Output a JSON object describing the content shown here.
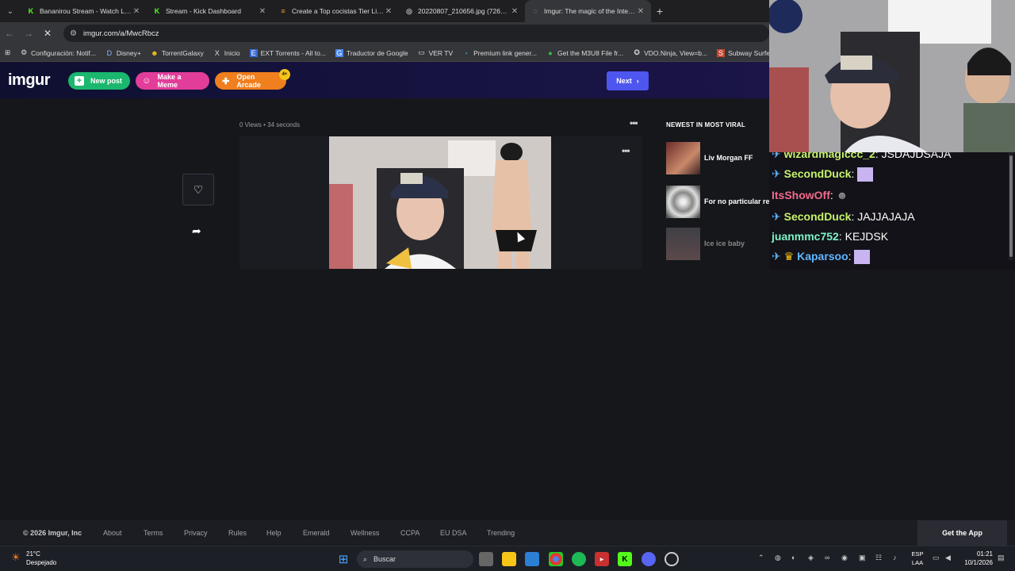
{
  "browser": {
    "tabs": [
      {
        "title": "Bananirou Stream - Watch Live",
        "icon": "kick-icon",
        "color": "#53fc18"
      },
      {
        "title": "Stream - Kick Dashboard",
        "icon": "kick-icon",
        "color": "#53fc18"
      },
      {
        "title": "Create a Top cocistas Tier List -",
        "icon": "tierlist-icon",
        "color": "#e0a030"
      },
      {
        "title": "20220807_210656.jpg (726×96…",
        "icon": "globe-icon",
        "color": "#bbbbbb"
      },
      {
        "title": "Imgur: The magic of the Interne",
        "icon": "loading-icon",
        "color": "#bbbbbb"
      }
    ],
    "url": "imgur.com/a/MwcRbcz",
    "bookmarks": [
      {
        "label": "Configuración: Notif...",
        "icon": "gear-icon"
      },
      {
        "label": "Disney+",
        "icon": "disney-icon"
      },
      {
        "label": "TorrentGalaxy",
        "icon": "galaxy-icon"
      },
      {
        "label": "Inicio",
        "icon": "x-icon"
      },
      {
        "label": "EXT Torrents - All to...",
        "icon": "ext-icon"
      },
      {
        "label": "Traductor de Google",
        "icon": "translate-icon"
      },
      {
        "label": "VER TV",
        "icon": "folder-icon"
      },
      {
        "label": "Premium link gener...",
        "icon": "link-icon"
      },
      {
        "label": "Get the M3U8 File fr...",
        "icon": "green-dot-icon"
      },
      {
        "label": "VDO.Ninja, View=b...",
        "icon": "vdo-icon"
      },
      {
        "label": "Subway Surfers Web",
        "icon": "subway-icon"
      }
    ]
  },
  "imgur": {
    "logo": "imgur",
    "new_post": "New post",
    "make_meme": "Make a Meme",
    "open_arcade": "Open Arcade",
    "arcade_badge": "4+",
    "next": "Next",
    "views": "0 Views",
    "sep": "•",
    "time": "34 seconds",
    "viral_header": "NEWEST IN MOST VIRAL",
    "viral": [
      {
        "title": "Liv Morgan FF"
      },
      {
        "title": "For no particular reason..."
      },
      {
        "title": "Ice ice baby"
      }
    ]
  },
  "footer": {
    "copyright": "© 2026 Imgur, Inc",
    "links": [
      "About",
      "Terms",
      "Privacy",
      "Rules",
      "Help",
      "Emerald",
      "Wellness",
      "CCPA",
      "EU DSA",
      "Trending"
    ],
    "get_app": "Get the App"
  },
  "taskbar": {
    "temp": "21°C",
    "weather": "Despejado",
    "search_placeholder": "Buscar",
    "lang1": "ESP",
    "lang2": "LAA",
    "time": "01:21",
    "date": "10/1/2026"
  },
  "chat": {
    "messages": [
      {
        "user": "wizardmagiccc_2",
        "text": " JSDAJDSAJA",
        "color": "#c6f26a"
      },
      {
        "user": "SecondDuck",
        "text": "",
        "color": "#c6f26a"
      },
      {
        "user": "ItsShowOff",
        "text": "",
        "color": "#f26a8a"
      },
      {
        "user": "SecondDuck",
        "text": " JAJJAJAJA",
        "color": "#c6f26a"
      },
      {
        "user": "juanmmc752",
        "text": " KEJDSK",
        "color": "#7ff2c8"
      },
      {
        "user": "Kaparsoo",
        "text": "",
        "color": "#5fb6ff"
      }
    ]
  }
}
